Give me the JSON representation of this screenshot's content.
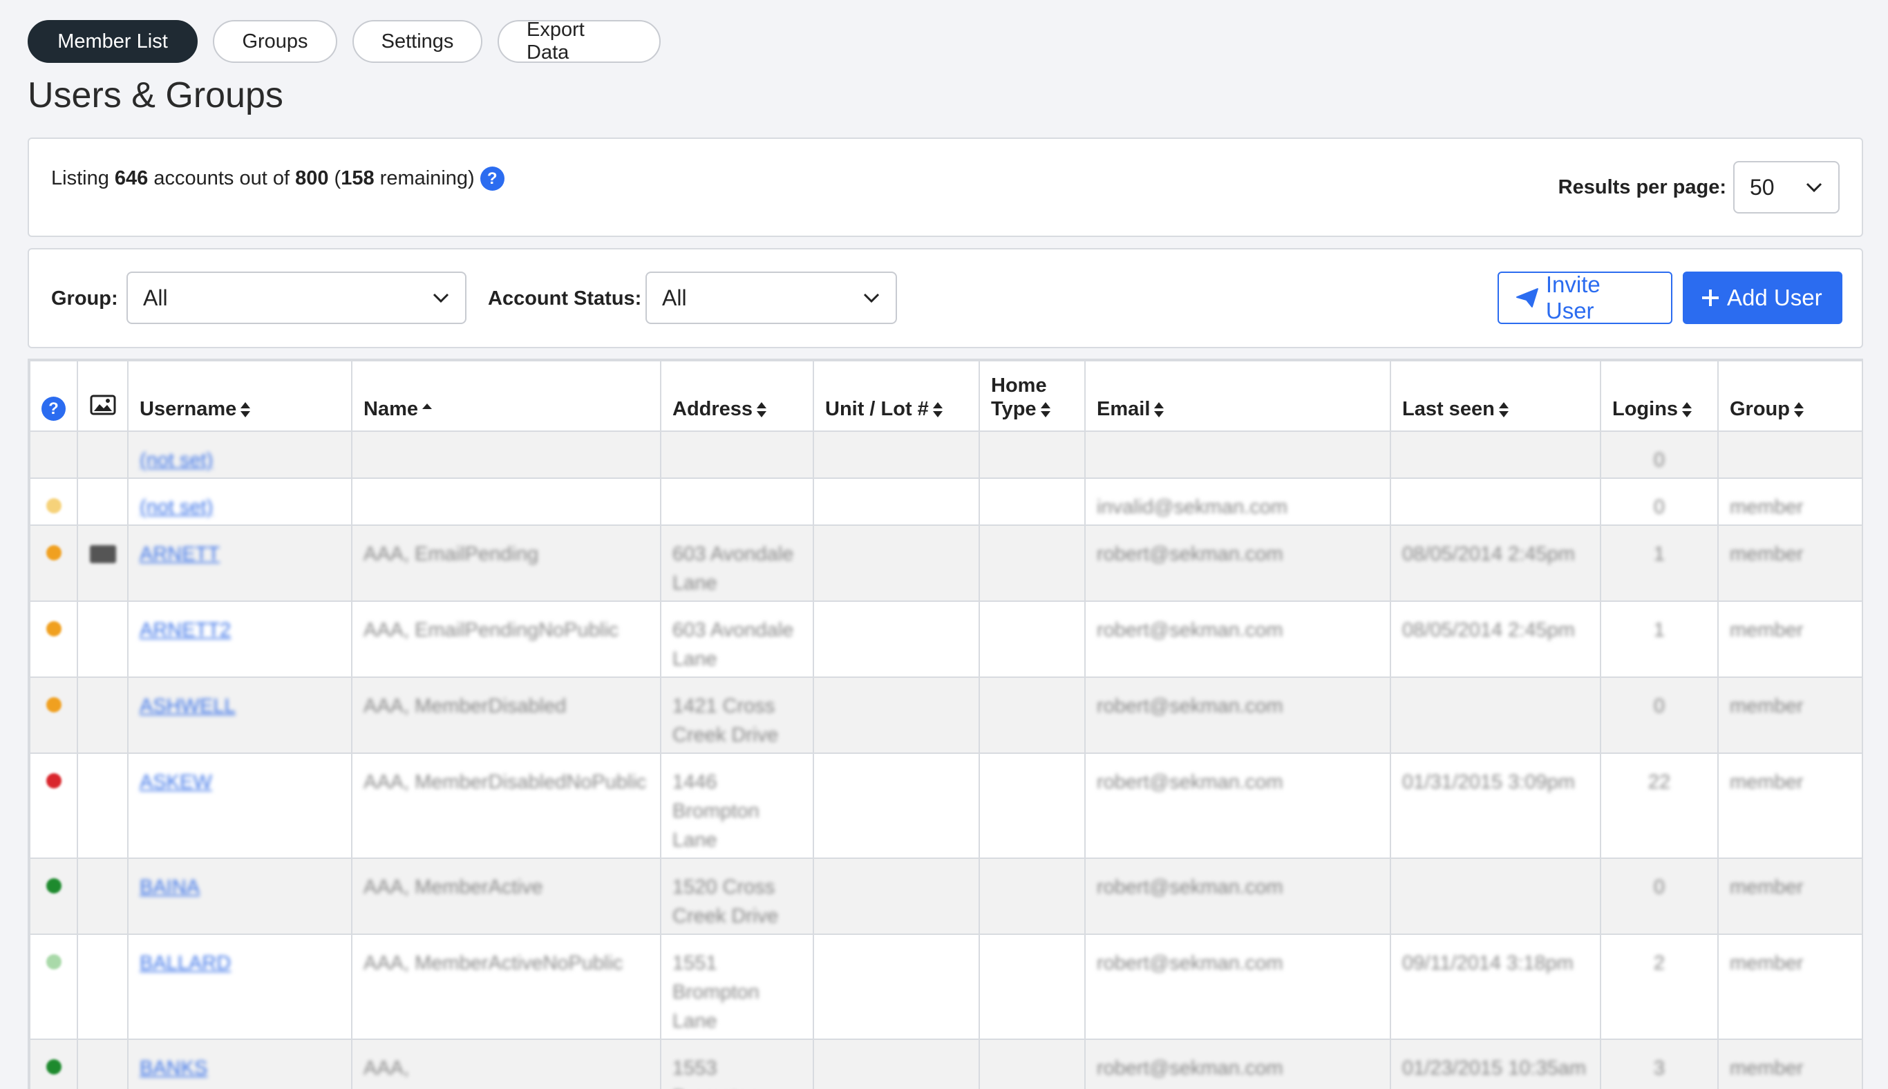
{
  "tabs": [
    "Member List",
    "Groups",
    "Settings",
    "Export Data"
  ],
  "page_title": "Users & Groups",
  "summary": {
    "listing": "Listing",
    "shown": "646",
    "accounts_out_of": "accounts out of",
    "total": "800",
    "open_paren": "(",
    "remaining": "158",
    "remaining_label": "remaining)",
    "help": "?"
  },
  "results_per_page": {
    "label": "Results per page:",
    "value": "50"
  },
  "filters": {
    "group_label": "Group:",
    "group_value": "All",
    "status_label": "Account Status:",
    "status_value": "All",
    "invite_label": "Invite User",
    "add_label": "Add User"
  },
  "colors": {
    "primary": "#2b6cf0",
    "active_tab": "#1f2a33"
  },
  "table": {
    "headers": {
      "help": "?",
      "username": "Username",
      "name": "Name",
      "address": "Address",
      "unit": "Unit / Lot #",
      "home_type_1": "Home",
      "home_type_2": "Type",
      "email": "Email",
      "last_seen": "Last seen",
      "logins": "Logins",
      "group": "Group"
    },
    "rows": [
      {
        "status_color": "",
        "photo": false,
        "username": "(not set)",
        "name": "",
        "address": [
          "",
          "",
          ""
        ],
        "unit": "",
        "home": "",
        "email": "",
        "last_seen": "",
        "logins": "0",
        "group": ""
      },
      {
        "status_color": "#f6d27a",
        "photo": false,
        "username": "(not set)",
        "name": "",
        "address": [
          "",
          "",
          ""
        ],
        "unit": "",
        "home": "",
        "email": "invalid@sekman.com",
        "last_seen": "",
        "logins": "0",
        "group": "member"
      },
      {
        "status_color": "#f0a020",
        "photo": true,
        "username": "ARNETT",
        "name": "AAA, EmailPending",
        "address": [
          "603 Avondale",
          "Lane",
          ""
        ],
        "unit": "",
        "home": "",
        "email": "robert@sekman.com",
        "last_seen": "08/05/2014 2:45pm",
        "logins": "1",
        "group": "member"
      },
      {
        "status_color": "#f0a020",
        "photo": false,
        "username": "ARNETT2",
        "name": "AAA, EmailPendingNoPublic",
        "address": [
          "603 Avondale",
          "Lane",
          ""
        ],
        "unit": "",
        "home": "",
        "email": "robert@sekman.com",
        "last_seen": "08/05/2014 2:45pm",
        "logins": "1",
        "group": "member"
      },
      {
        "status_color": "#f0a020",
        "photo": false,
        "username": "ASHWELL",
        "name": "AAA, MemberDisabled",
        "address": [
          "1421 Cross",
          "Creek Drive",
          ""
        ],
        "unit": "",
        "home": "",
        "email": "robert@sekman.com",
        "last_seen": "",
        "logins": "0",
        "group": "member"
      },
      {
        "status_color": "#d9262c",
        "photo": false,
        "username": "ASKEW",
        "name": "AAA, MemberDisabledNoPublic",
        "address": [
          "1446",
          "Brompton",
          "Lane"
        ],
        "unit": "",
        "home": "",
        "email": "robert@sekman.com",
        "last_seen": "01/31/2015 3:09pm",
        "logins": "22",
        "group": "member"
      },
      {
        "status_color": "#1e8a2e",
        "photo": false,
        "username": "BAINA",
        "name": "AAA, MemberActive",
        "address": [
          "1520 Cross",
          "Creek Drive",
          ""
        ],
        "unit": "",
        "home": "",
        "email": "robert@sekman.com",
        "last_seen": "",
        "logins": "0",
        "group": "member"
      },
      {
        "status_color": "#a9d9a9",
        "photo": false,
        "username": "BALLARD",
        "name": "AAA, MemberActiveNoPublic",
        "address": [
          "1551",
          "Brompton",
          "Lane"
        ],
        "unit": "",
        "home": "",
        "email": "robert@sekman.com",
        "last_seen": "09/11/2014 3:18pm",
        "logins": "2",
        "group": "member"
      },
      {
        "status_color": "#1e8a2e",
        "photo": false,
        "username": "BANKS",
        "name": "AAA,",
        "address": [
          "1553",
          "Brompton",
          ""
        ],
        "unit": "",
        "home": "",
        "email": "robert@sekman.com",
        "last_seen": "01/23/2015 10:35am",
        "logins": "3",
        "group": "member"
      }
    ]
  }
}
